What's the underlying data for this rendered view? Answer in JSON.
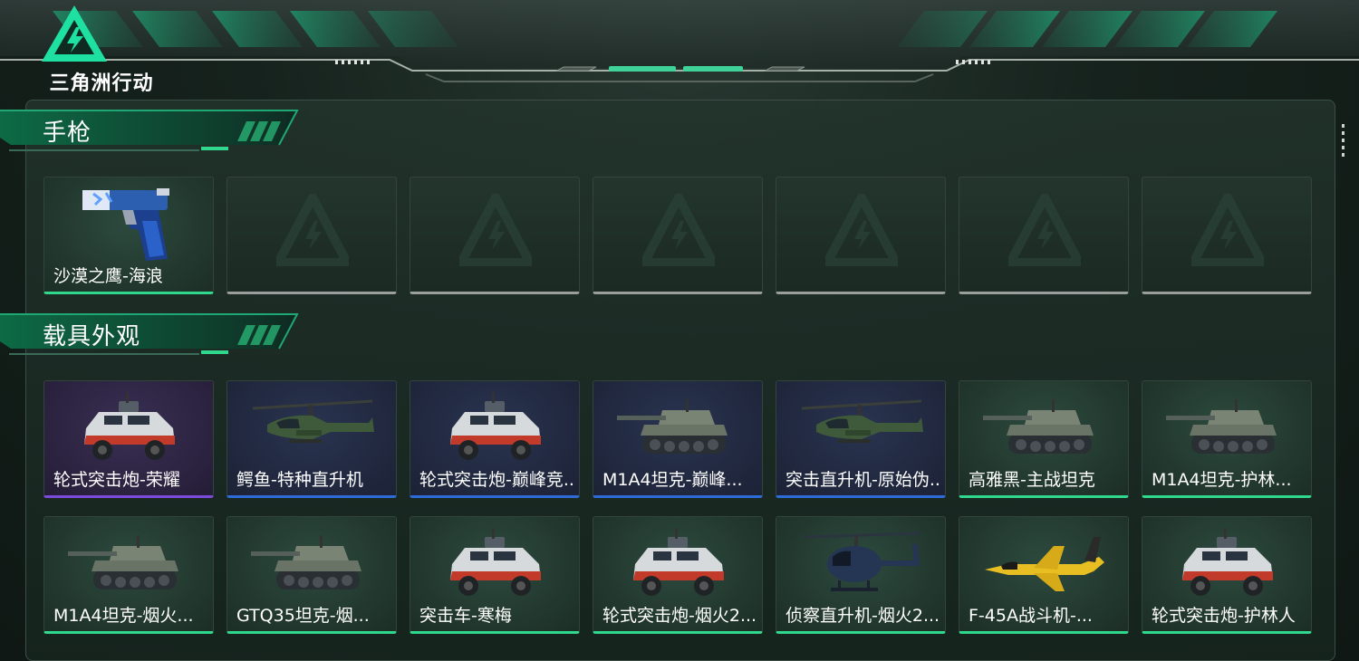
{
  "brand": {
    "logo_text": "三角洲行动"
  },
  "colors": {
    "accent_green": "#2fd88c",
    "accent_blue": "#2f6bd8",
    "accent_purple": "#7c4bdc"
  },
  "sections": [
    {
      "title": "手枪",
      "items": [
        {
          "label": "沙漠之鹰-海浪",
          "rarity": "green",
          "icon": "pistol"
        },
        {
          "label": "",
          "rarity": "empty",
          "icon": "placeholder-logo"
        },
        {
          "label": "",
          "rarity": "empty",
          "icon": "placeholder-logo"
        },
        {
          "label": "",
          "rarity": "empty",
          "icon": "placeholder-logo"
        },
        {
          "label": "",
          "rarity": "empty",
          "icon": "placeholder-logo"
        },
        {
          "label": "",
          "rarity": "empty",
          "icon": "placeholder-logo"
        },
        {
          "label": "",
          "rarity": "empty",
          "icon": "placeholder-logo"
        }
      ]
    },
    {
      "title": "载具外观",
      "items": [
        {
          "label": "轮式突击炮-荣耀",
          "rarity": "purple",
          "icon": "armored-car"
        },
        {
          "label": "鳄鱼-特种直升机",
          "rarity": "blue",
          "icon": "helicopter"
        },
        {
          "label": "轮式突击炮-巅峰竞...",
          "rarity": "blue",
          "icon": "armored-car"
        },
        {
          "label": "M1A4坦克-巅峰...",
          "rarity": "blue",
          "icon": "tank"
        },
        {
          "label": "突击直升机-原始伪...",
          "rarity": "blue",
          "icon": "helicopter"
        },
        {
          "label": "高雅黑-主战坦克",
          "rarity": "green",
          "icon": "tank"
        },
        {
          "label": "M1A4坦克-护林...",
          "rarity": "green",
          "icon": "tank"
        },
        {
          "label": "M1A4坦克-烟火...",
          "rarity": "green",
          "icon": "tank"
        },
        {
          "label": "GTQ35坦克-烟...",
          "rarity": "green",
          "icon": "tank"
        },
        {
          "label": "突击车-寒梅",
          "rarity": "green",
          "icon": "armored-car"
        },
        {
          "label": "轮式突击炮-烟火2...",
          "rarity": "green",
          "icon": "armored-car"
        },
        {
          "label": "侦察直升机-烟火2...",
          "rarity": "green",
          "icon": "scout-helicopter"
        },
        {
          "label": "F-45A战斗机-...",
          "rarity": "green",
          "icon": "jet"
        },
        {
          "label": "轮式突击炮-护林人",
          "rarity": "green",
          "icon": "armored-car"
        }
      ]
    }
  ]
}
